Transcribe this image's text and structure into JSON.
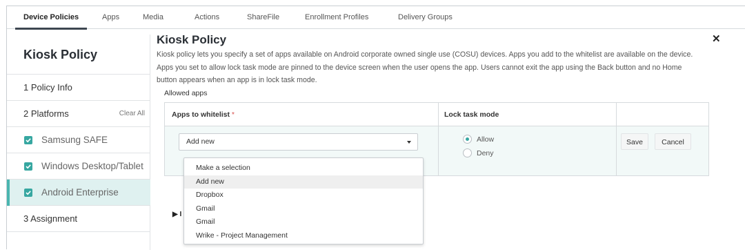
{
  "nav": {
    "tabs": [
      "Device Policies",
      "Apps",
      "Media",
      "Actions",
      "ShareFile",
      "Enrollment Profiles",
      "Delivery Groups"
    ],
    "active": "Device Policies"
  },
  "sidebar": {
    "title": "Kiosk Policy",
    "steps": {
      "policy_info": "1  Policy Info",
      "platforms": "2  Platforms",
      "clear_all": "Clear All",
      "assignment": "3  Assignment"
    },
    "platforms": [
      {
        "label": "Samsung SAFE",
        "checked": true
      },
      {
        "label": "Windows Desktop/Tablet",
        "checked": true
      },
      {
        "label": "Android Enterprise",
        "checked": true,
        "active": true
      }
    ]
  },
  "main": {
    "title": "Kiosk Policy",
    "close_icon": "close-icon",
    "description": "Kiosk policy lets you specify a set of apps available on Android corporate owned single use (COSU) devices. Apps you add to the whitelist are available on the device. Apps you set to allow lock task mode are pinned to the device screen when the user opens the app. Users cannot exit the app using the Back button and no Home button appears when an app is in lock task mode.",
    "allowed_apps_label": "Allowed apps",
    "table": {
      "col_apps": "Apps to whitelist",
      "required_mark": "*",
      "col_lock": "Lock task mode",
      "select_value": "Add new",
      "radio_allow": "Allow",
      "radio_deny": "Deny",
      "radio_selected": "Allow",
      "save": "Save",
      "cancel": "Cancel"
    },
    "dropdown_options": [
      "Make a selection",
      "Add new",
      "Dropbox",
      "Gmail",
      "Gmail",
      "Wrike - Project Management"
    ],
    "dropdown_highlighted": "Add new",
    "expander_label": "I"
  },
  "colors": {
    "accent": "#37a7a1",
    "active_row": "#dff1f0",
    "editing_row": "#f2f9f8"
  }
}
